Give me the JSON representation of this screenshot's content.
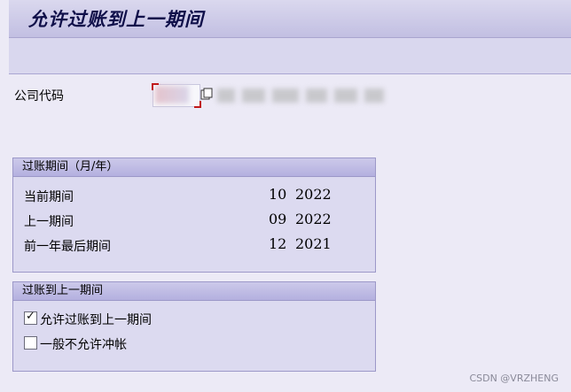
{
  "window": {
    "title": "允许过账到上一期间"
  },
  "company_code": {
    "label": "公司代码",
    "value": ""
  },
  "posting_period_group": {
    "title": "过账期间（月/年）",
    "rows": [
      {
        "label": "当前期间",
        "month": "10",
        "year": "2022"
      },
      {
        "label": "上一期间",
        "month": "09",
        "year": "2022"
      },
      {
        "label": "前一年最后期间",
        "month": "12",
        "year": "2021"
      }
    ]
  },
  "posting_prev_group": {
    "title": "过账到上一期间",
    "options": [
      {
        "label": "允许过账到上一期间",
        "checked": true
      },
      {
        "label": "一般不允许冲帐",
        "checked": false
      }
    ]
  },
  "watermark": "CSDN @VRZHENG",
  "colors": {
    "title": "#10104a",
    "accent": "#c01818",
    "background": "#eceaf6"
  },
  "icons": {
    "help": "value-help-icon"
  }
}
